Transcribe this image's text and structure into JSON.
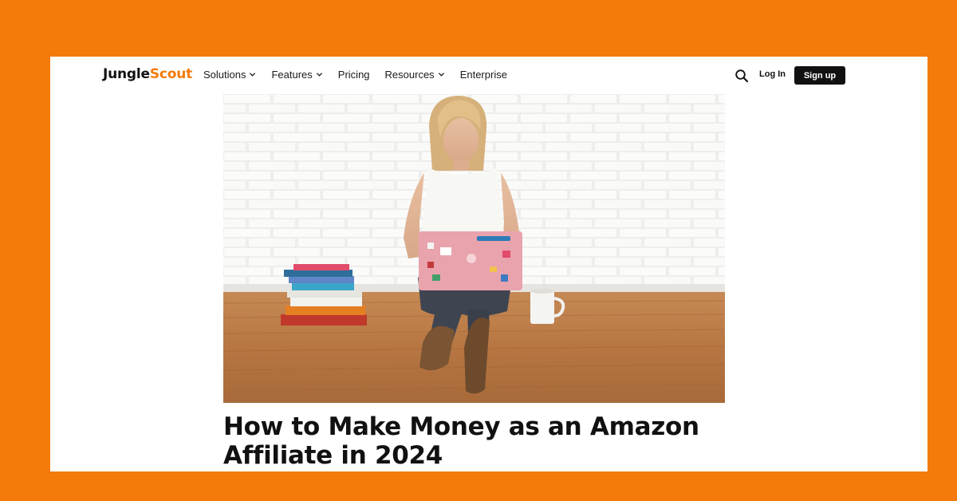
{
  "logo": {
    "part1": "Jungle",
    "part2": "Scout"
  },
  "nav": [
    {
      "label": "Solutions",
      "dropdown": true
    },
    {
      "label": "Features",
      "dropdown": true
    },
    {
      "label": "Pricing",
      "dropdown": false
    },
    {
      "label": "Resources",
      "dropdown": true
    },
    {
      "label": "Enterprise",
      "dropdown": false
    }
  ],
  "header": {
    "login_label": "Log In",
    "signup_label": "Sign up"
  },
  "article": {
    "title": "How to Make Money as an Amazon Affiliate in 2024"
  },
  "colors": {
    "brand_orange": "#F47B0A",
    "text_dark": "#111111",
    "background_page": "#ffffff"
  },
  "icons": {
    "search": "search-icon",
    "dropdown": "chevron-down-icon"
  }
}
